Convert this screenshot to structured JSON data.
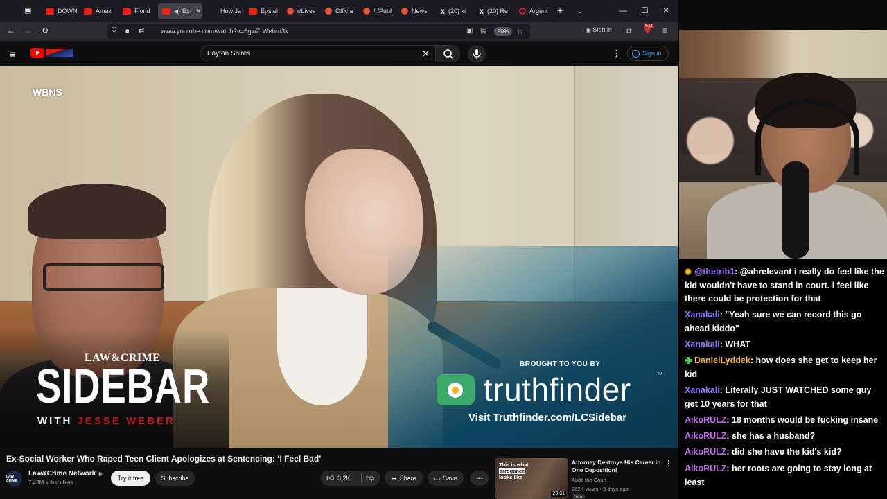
{
  "browser": {
    "tabs": [
      {
        "label": "DOWN",
        "favicon": "youtube-icon"
      },
      {
        "label": "Amaz",
        "favicon": "youtube-icon"
      },
      {
        "label": "Florid",
        "favicon": "youtube-icon"
      },
      {
        "label": "Ex-",
        "favicon": "youtube-icon",
        "active": true
      },
      {
        "label": "How Ja",
        "favicon": "none"
      },
      {
        "label": "Epstei",
        "favicon": "youtube-icon"
      },
      {
        "label": "r/Lives",
        "favicon": "reddit-icon"
      },
      {
        "label": "Officia",
        "favicon": "reddit-icon"
      },
      {
        "label": "/r/Publ",
        "favicon": "reddit-icon"
      },
      {
        "label": "News",
        "favicon": "reddit-icon"
      },
      {
        "label": "(20) ki",
        "favicon": "x-icon"
      },
      {
        "label": "(20) Re",
        "favicon": "x-icon"
      },
      {
        "label": "Argent",
        "favicon": "loading-icon"
      }
    ],
    "url": "www.youtube.com/watch?v=6gwZrWehm3k",
    "zoom": "90%",
    "signin": "Sign in",
    "ext_badge": "611"
  },
  "youtube": {
    "search_query": "Payton Shires",
    "signin": "Sign in"
  },
  "video": {
    "station_bug": "WBNS",
    "show_brand": "LAW&CRIME",
    "show_title": "SIDEBAR",
    "with_prefix": "WITH",
    "host_name": "JESSE WEBER",
    "sponsor_intro": "BROUGHT TO YOU BY",
    "sponsor_name": "truthfinder",
    "sponsor_tm": "™",
    "sponsor_url": "Visit Truthfinder.com/LCSidebar",
    "title": "Ex-Social Worker Who Raped Teen Client Apologizes at Sentencing: ‘I Feel Bad’",
    "channel": "Law&Crime Network",
    "channel_avatar_text": "LAW CRIME",
    "subscribers": "7.43M subscribers",
    "try_free": "Try it free",
    "subscribe": "Subscribe",
    "likes": "3.2K",
    "share": "Share",
    "save": "Save"
  },
  "recommended": {
    "thumb_caption_1": "This is what",
    "thumb_caption_2": "arrogance",
    "thumb_caption_3": "looks like",
    "duration": "23:31",
    "title": "Attorney Destroys His Career in One Deposition!",
    "channel": "Audit the Court",
    "meta": "262K views • 3 days ago",
    "badge": "New"
  },
  "chat": {
    "messages": [
      {
        "user": "@thetrib1",
        "color": "#9b6bff",
        "badge": "ring",
        "text": ": @ahrelevant i really do feel like the kid wouldn't have to stand in court. i feel like there could be protection for that"
      },
      {
        "user": "Xanakali",
        "color": "#8a7dff",
        "badge": "",
        "text": ": \"Yeah sure we can record this go ahead kiddo\""
      },
      {
        "user": "Xanakali",
        "color": "#8a7dff",
        "badge": "",
        "text": ": WHAT"
      },
      {
        "user": "DanielLyddek",
        "color": "#f3b33c",
        "badge": "cross",
        "text": ": how does she get to keep her kid"
      },
      {
        "user": "Xanakali",
        "color": "#8a7dff",
        "badge": "",
        "text": ": Literally JUST WATCHED some guy get 10 years for that"
      },
      {
        "user": "AikoRULZ",
        "color": "#c46bf0",
        "badge": "",
        "text": ": 18 months would be fucking insane"
      },
      {
        "user": "AikoRULZ",
        "color": "#c46bf0",
        "badge": "",
        "text": ": she has a husband?"
      },
      {
        "user": "AikoRULZ",
        "color": "#c46bf0",
        "badge": "",
        "text": ": did she have the kid's kid?"
      },
      {
        "user": "AikoRULZ",
        "color": "#c46bf0",
        "badge": "",
        "text": ": her roots are going to stay long at least"
      }
    ]
  }
}
